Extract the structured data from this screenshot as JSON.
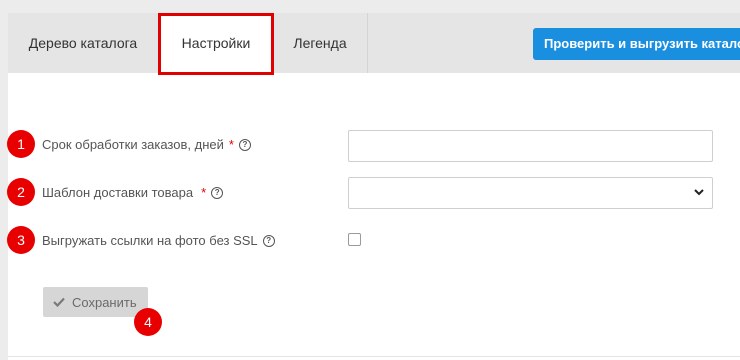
{
  "tabs": [
    {
      "label": "Дерево каталога"
    },
    {
      "label": "Настройки"
    },
    {
      "label": "Легенда"
    }
  ],
  "primary_action": {
    "label": "Проверить и выгрузить каталог"
  },
  "form": {
    "processing_time": {
      "label": "Срок обработки заказов, дней",
      "required": "*",
      "help": "?",
      "value": ""
    },
    "delivery_template": {
      "label": "Шаблон доставки товара",
      "required": "*",
      "help": "?",
      "value": ""
    },
    "ssl_links": {
      "label": "Выгружать ссылки на фото без SSL",
      "help": "?",
      "checked": false
    }
  },
  "save_button": {
    "label": "Сохранить"
  },
  "annotations": [
    "1",
    "2",
    "3",
    "4"
  ],
  "colors": {
    "accent": "#1a8fe0",
    "annotation": "#e80000",
    "required": "#e00000"
  }
}
